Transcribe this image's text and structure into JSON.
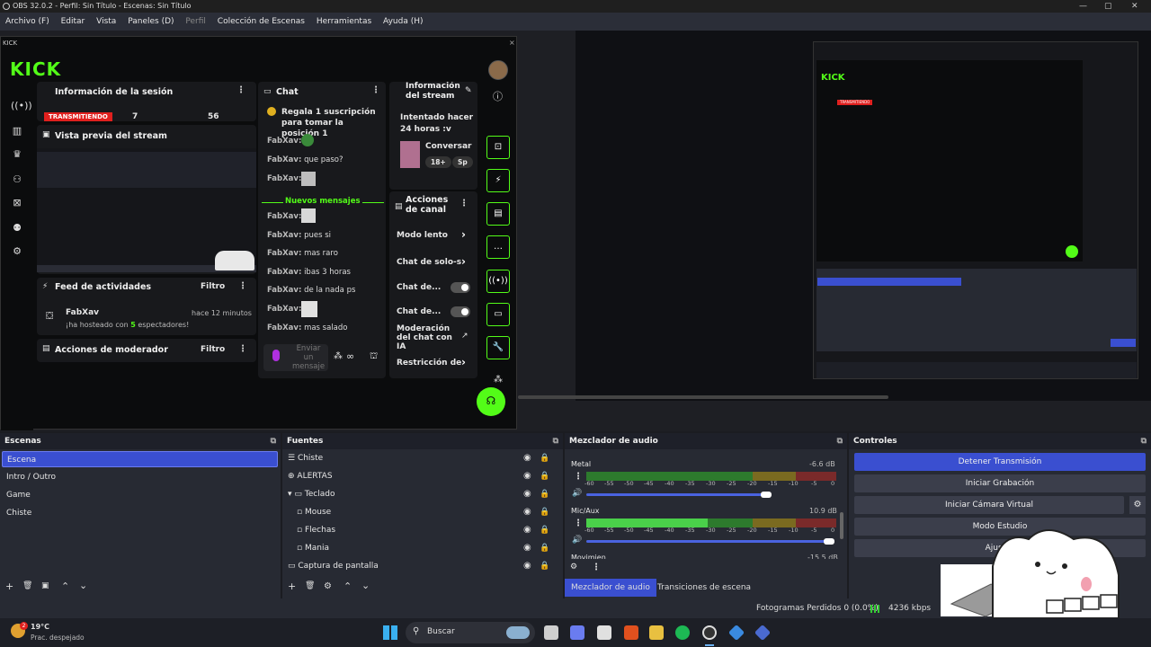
{
  "window": {
    "title": "OBS 32.0.2 - Perfil: Sin Título - Escenas: Sin Título"
  },
  "menu": [
    "Archivo (F)",
    "Editar",
    "Vista",
    "Paneles (D)",
    "Perfil",
    "Colección de Escenas",
    "Herramientas",
    "Ayuda (H)"
  ],
  "kick": {
    "window_label": "KICK",
    "logo": "KICK",
    "session": {
      "title": "Información de la sesión",
      "status": "TRANSMITIENDO",
      "viewers": "7",
      "followers": "56"
    },
    "preview_title": "Vista previa del stream",
    "feed": {
      "title": "Feed de actividades",
      "filter": "Filtro",
      "user": "FabXav",
      "time": "hace 12 minutos",
      "msg_pre": "¡ha hosteado con ",
      "msg_count": "5",
      "msg_post": " espectadores!"
    },
    "mod": {
      "title": "Acciones de moderador",
      "filter": "Filtro"
    },
    "chat": {
      "title": "Chat",
      "pinned": "Regala 1 suscripción para tomar la posición 1",
      "new_messages": "Nuevos mensajes",
      "lines": [
        {
          "user": "FabXav:",
          "text": ""
        },
        {
          "user": "FabXav:",
          "text": "que paso?"
        },
        {
          "user": "FabXav:",
          "text": ""
        },
        {
          "user": "FabXav:",
          "text": ""
        },
        {
          "user": "FabXav:",
          "text": "pues si"
        },
        {
          "user": "FabXav:",
          "text": "mas raro"
        },
        {
          "user": "FabXav:",
          "text": "ibas 3 horas"
        },
        {
          "user": "FabXav:",
          "text": "de la nada ps"
        },
        {
          "user": "FabXav:",
          "text": ""
        },
        {
          "user": "FabXav:",
          "text": "mas salado"
        }
      ],
      "send_placeholder": "Enviar un mensaje"
    },
    "stream_info": {
      "title": "Información del stream",
      "stream_title": "Intentado hacer 24 horas :v",
      "category": "Conversar",
      "tag1": "18+",
      "tag2": "Sp"
    },
    "channel_actions": {
      "title": "Acciones de canal",
      "items": [
        "Modo lento",
        "Chat de solo-s",
        "Chat de...",
        "Chat de...",
        "Moderación del chat con IA",
        "Restricción de"
      ]
    }
  },
  "docks": {
    "scenes": {
      "title": "Escenas",
      "items": [
        "Escena",
        "Intro / Outro",
        "Game",
        "Chiste"
      ]
    },
    "sources": {
      "title": "Fuentes",
      "items": [
        "Chiste",
        "ALERTAS",
        "Teclado",
        "Mouse",
        "Flechas",
        "Mania",
        "Captura de pantalla"
      ]
    },
    "mixer": {
      "title": "Mezclador de audio",
      "channels": [
        {
          "name": "Metal",
          "db": "-6.6 dB"
        },
        {
          "name": "Mic/Aux",
          "db": "10.9 dB"
        },
        {
          "name": "Movimien",
          "db": "-15.5 dB"
        }
      ],
      "scale": [
        "-60",
        "-55",
        "-50",
        "-45",
        "-40",
        "-35",
        "-30",
        "-25",
        "-20",
        "-15",
        "-10",
        "-5",
        "0"
      ],
      "tabs": [
        "Mezclador de audio",
        "Transiciones de escena"
      ]
    },
    "controls": {
      "title": "Controles",
      "buttons": [
        "Detener Transmisión",
        "Iniciar Grabación",
        "Iniciar Cámara Virtual",
        "Modo Estudio",
        "Ajustes"
      ]
    }
  },
  "status": {
    "dropped": "Fotogramas Perdidos 0 (0.0%)",
    "bitrate": "4236 kbps"
  },
  "taskbar": {
    "temp": "19°C",
    "weather": "Prac. despejado",
    "search": "Buscar",
    "badge": "2"
  },
  "colors": {
    "kick_green": "#53fc18",
    "obs_accent": "#3a4fd0",
    "live_red": "#e0201e"
  }
}
